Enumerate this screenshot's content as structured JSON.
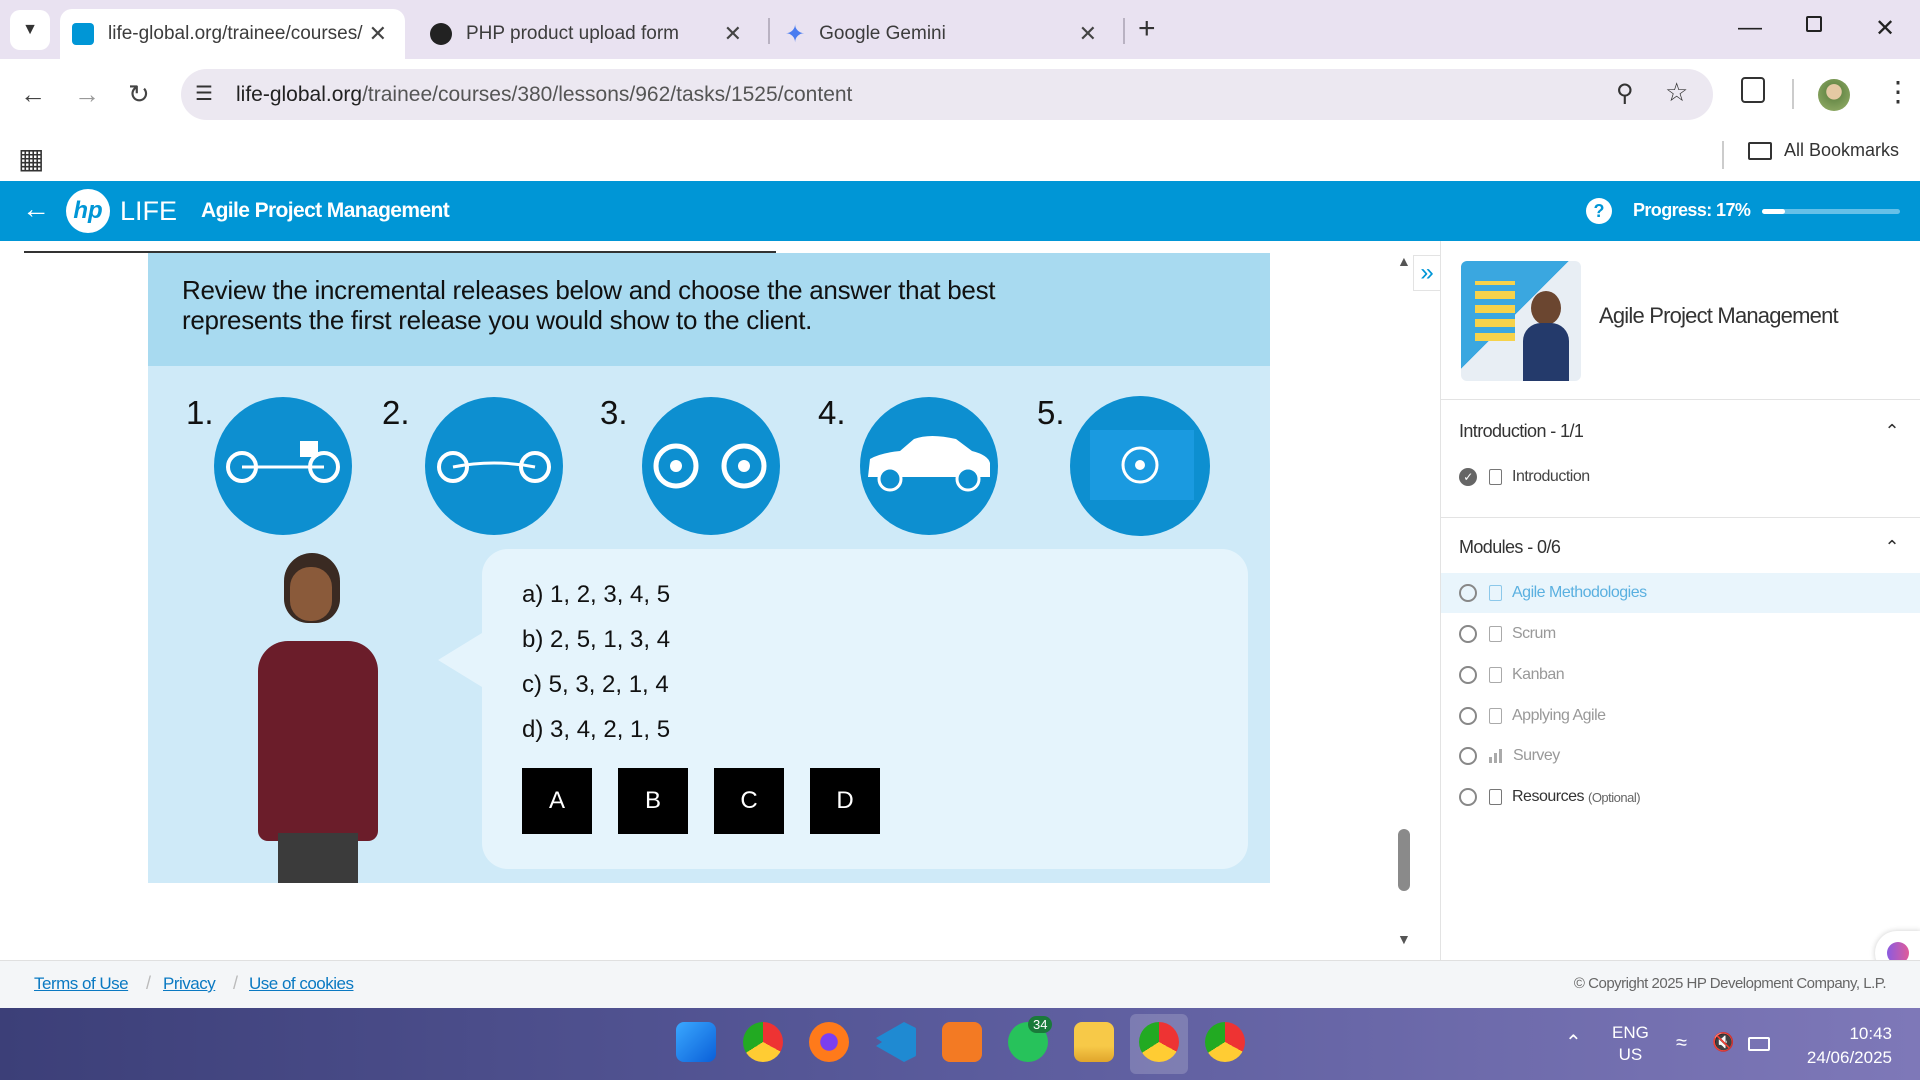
{
  "browser": {
    "tabs": [
      {
        "title": "life-global.org/trainee/courses/",
        "active": true
      },
      {
        "title": "PHP product upload form",
        "active": false
      },
      {
        "title": "Google Gemini",
        "active": false
      }
    ],
    "url_host": "life-global.org",
    "url_path": "/trainee/courses/380/lessons/962/tasks/1525/content",
    "bookmarks_label": "All Bookmarks"
  },
  "site_header": {
    "brand": "LIFE",
    "logo_text": "hp",
    "course_title": "Agile Project Management",
    "help_icon": "?",
    "progress_label": "Progress:",
    "progress_value": "17%",
    "progress_fraction": 0.17
  },
  "slide": {
    "question": "Review the incremental releases below and choose the answer that best represents the first release you would show to the client.",
    "item_numbers": [
      "1.",
      "2.",
      "3.",
      "4.",
      "5."
    ],
    "options": [
      "a) 1, 2, 3, 4, 5",
      "b) 2, 5, 1, 3, 4",
      "c) 5, 3, 2, 1, 4",
      "d) 3, 4, 2, 1, 5"
    ],
    "answers": [
      "A",
      "B",
      "C",
      "D"
    ]
  },
  "sidebar": {
    "course_title": "Agile Project Management",
    "sections": [
      {
        "title": "Introduction - 1/1",
        "items": [
          {
            "label": "Introduction",
            "done": true,
            "icon": "doc-icon"
          }
        ]
      },
      {
        "title": "Modules - 0/6",
        "items": [
          {
            "label": "Agile Methodologies",
            "done": false,
            "icon": "doc-icon",
            "current": true
          },
          {
            "label": "Scrum",
            "done": false,
            "icon": "doc-icon"
          },
          {
            "label": "Kanban",
            "done": false,
            "icon": "doc-icon"
          },
          {
            "label": "Applying Agile",
            "done": false,
            "icon": "doc-icon"
          },
          {
            "label": "Survey",
            "done": false,
            "icon": "chart-icon"
          },
          {
            "label": "Resources",
            "suffix": "(Optional)",
            "done": false,
            "icon": "doc-icon"
          }
        ]
      }
    ]
  },
  "footer": {
    "links": [
      "Terms of Use",
      "Privacy",
      "Use of cookies"
    ],
    "copyright": "© Copyright 2025 HP Development Company, L.P."
  },
  "taskbar": {
    "lang_line1": "ENG",
    "lang_line2": "US",
    "time": "10:43",
    "date": "24/06/2025",
    "whatsapp_badge": "34"
  },
  "colors": {
    "brand_blue": "#0096d6",
    "slide_bg": "#cfeaf8",
    "slide_head": "#a8daf0",
    "circle_blue": "#0d8fd0"
  }
}
